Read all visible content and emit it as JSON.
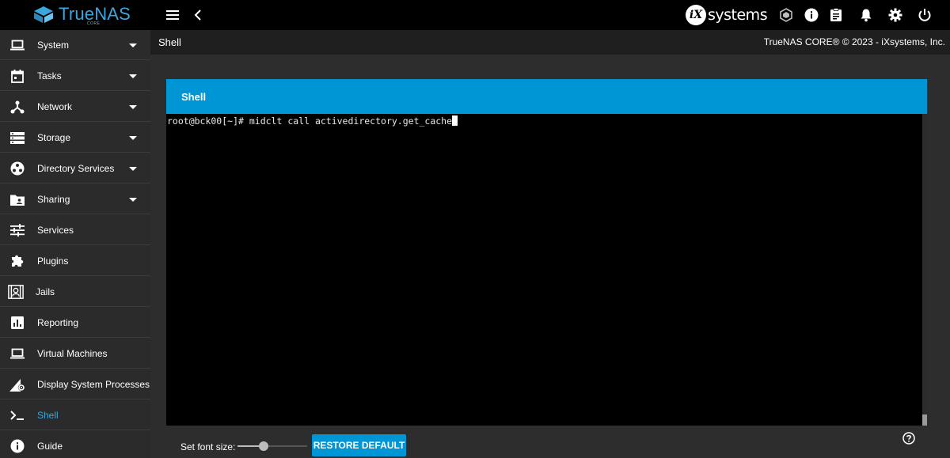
{
  "brand": {
    "name": "TrueNAS",
    "edition": "CORE"
  },
  "topbar": {
    "vendor_prefix": "iX",
    "vendor_suffix": "systems",
    "icons": [
      "menu-icon",
      "back-chevron-icon",
      "truecommand-icon",
      "info-icon",
      "clipboard-icon",
      "bell-icon",
      "gear-icon",
      "power-icon"
    ]
  },
  "sidebar": {
    "items": [
      {
        "label": "System",
        "icon": "laptop-icon",
        "expandable": true
      },
      {
        "label": "Tasks",
        "icon": "calendar-icon",
        "expandable": true
      },
      {
        "label": "Network",
        "icon": "network-icon",
        "expandable": true
      },
      {
        "label": "Storage",
        "icon": "storage-icon",
        "expandable": true
      },
      {
        "label": "Directory Services",
        "icon": "directory-icon",
        "expandable": true
      },
      {
        "label": "Sharing",
        "icon": "folder-share-icon",
        "expandable": true
      },
      {
        "label": "Services",
        "icon": "tune-icon",
        "expandable": false
      },
      {
        "label": "Plugins",
        "icon": "puzzle-icon",
        "expandable": false
      },
      {
        "label": "Jails",
        "icon": "jail-icon",
        "expandable": false
      },
      {
        "label": "Reporting",
        "icon": "chart-icon",
        "expandable": false
      },
      {
        "label": "Virtual Machines",
        "icon": "monitor-icon",
        "expandable": false
      },
      {
        "label": "Display System Processes",
        "icon": "processes-icon",
        "expandable": false
      },
      {
        "label": "Shell",
        "icon": "terminal-icon",
        "expandable": false,
        "active": true
      },
      {
        "label": "Guide",
        "icon": "info-circle-icon",
        "expandable": false
      }
    ]
  },
  "page": {
    "title": "Shell",
    "copyright": "TrueNAS CORE® © 2023 - iXsystems, Inc."
  },
  "shell": {
    "header": "Shell",
    "prompt": "root@bck00[~]# ",
    "command": "midclt call activedirectory.get_cache",
    "font_size_label": "Set font size:",
    "restore_label": "RESTORE DEFAULT",
    "font_size_fraction": 0.38
  },
  "colors": {
    "accent": "#0095d5",
    "brand_blue": "#3aa6dd",
    "sidebar_bg": "#2b2b2b",
    "topbar_bg": "#000000"
  }
}
